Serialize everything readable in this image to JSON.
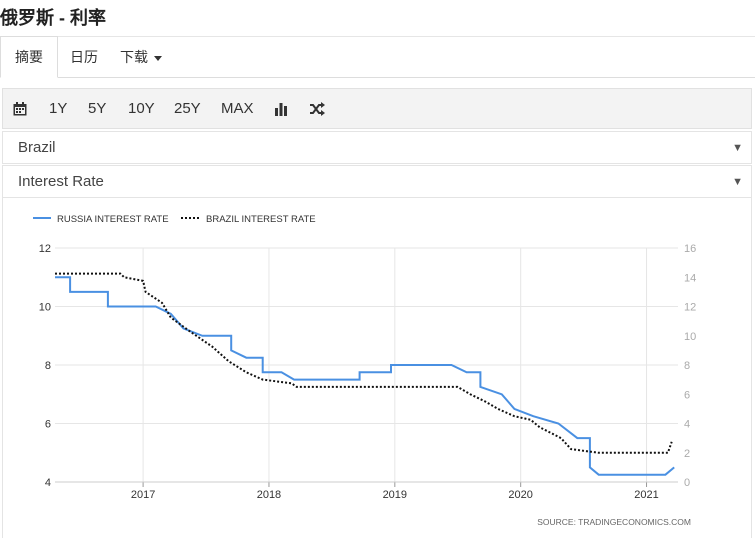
{
  "page": {
    "title": "俄罗斯 - 利率"
  },
  "tabs": [
    {
      "label": "摘要",
      "active": true
    },
    {
      "label": "日历",
      "active": false
    },
    {
      "label": "下载",
      "active": false,
      "dropdown": true
    }
  ],
  "toolbar": {
    "calendar_icon": "calendar-icon",
    "ranges": [
      "1Y",
      "5Y",
      "10Y",
      "25Y",
      "MAX"
    ],
    "chart_type_icon": "bar-chart-icon",
    "compare_icon": "shuffle-icon"
  },
  "selectors": {
    "country": "Brazil",
    "indicator": "Interest Rate"
  },
  "chart_data": {
    "type": "line",
    "source": "SOURCE:  TRADINGECONOMICS.COM",
    "legend_position": "top-left",
    "grid": {
      "vertical": true,
      "horizontal": true
    },
    "x_ticks": [
      "2017",
      "2018",
      "2019",
      "2020",
      "2021"
    ],
    "x_range": [
      2016.3,
      2021.25
    ],
    "y_left": {
      "range": [
        4,
        12
      ],
      "ticks": [
        4,
        6,
        8,
        10,
        12
      ]
    },
    "y_right": {
      "range": [
        0,
        16
      ],
      "ticks": [
        0,
        2,
        4,
        6,
        8,
        10,
        12,
        14,
        16
      ]
    },
    "series": [
      {
        "name": "RUSSIA INTEREST RATE",
        "axis": "left",
        "color": "#4a90e2",
        "style": "solid",
        "points": [
          [
            2016.3,
            11.0
          ],
          [
            2016.42,
            11.0
          ],
          [
            2016.42,
            10.5
          ],
          [
            2016.72,
            10.5
          ],
          [
            2016.72,
            10.0
          ],
          [
            2017.1,
            10.0
          ],
          [
            2017.22,
            9.75
          ],
          [
            2017.32,
            9.25
          ],
          [
            2017.47,
            9.0
          ],
          [
            2017.7,
            9.0
          ],
          [
            2017.7,
            8.5
          ],
          [
            2017.82,
            8.25
          ],
          [
            2017.95,
            8.25
          ],
          [
            2017.95,
            7.75
          ],
          [
            2018.1,
            7.75
          ],
          [
            2018.2,
            7.5
          ],
          [
            2018.72,
            7.5
          ],
          [
            2018.72,
            7.75
          ],
          [
            2018.97,
            7.75
          ],
          [
            2018.97,
            7.75
          ],
          [
            2018.97,
            7.75
          ],
          [
            2018.97,
            8.0
          ],
          [
            2019.45,
            8.0
          ],
          [
            2019.57,
            7.75
          ],
          [
            2019.68,
            7.75
          ],
          [
            2019.68,
            7.25
          ],
          [
            2019.85,
            7.0
          ],
          [
            2019.95,
            6.5
          ],
          [
            2020.1,
            6.25
          ],
          [
            2020.3,
            6.0
          ],
          [
            2020.45,
            5.5
          ],
          [
            2020.55,
            5.5
          ],
          [
            2020.55,
            4.5
          ],
          [
            2020.62,
            4.25
          ],
          [
            2021.15,
            4.25
          ],
          [
            2021.22,
            4.5
          ]
        ]
      },
      {
        "name": "BRAZIL INTEREST RATE",
        "axis": "right",
        "color": "#111111",
        "style": "dotted",
        "points": [
          [
            2016.3,
            14.25
          ],
          [
            2016.82,
            14.25
          ],
          [
            2016.85,
            14.0
          ],
          [
            2017.0,
            13.75
          ],
          [
            2017.02,
            13.0
          ],
          [
            2017.15,
            12.25
          ],
          [
            2017.22,
            11.25
          ],
          [
            2017.38,
            10.25
          ],
          [
            2017.55,
            9.25
          ],
          [
            2017.68,
            8.25
          ],
          [
            2017.82,
            7.5
          ],
          [
            2017.95,
            7.0
          ],
          [
            2018.18,
            6.75
          ],
          [
            2018.22,
            6.5
          ],
          [
            2019.5,
            6.5
          ],
          [
            2019.6,
            6.0
          ],
          [
            2019.72,
            5.5
          ],
          [
            2019.82,
            5.0
          ],
          [
            2019.95,
            4.5
          ],
          [
            2020.08,
            4.25
          ],
          [
            2020.15,
            3.75
          ],
          [
            2020.32,
            3.0
          ],
          [
            2020.4,
            2.25
          ],
          [
            2020.62,
            2.0
          ],
          [
            2021.17,
            2.0
          ],
          [
            2021.2,
            2.75
          ]
        ]
      }
    ]
  }
}
